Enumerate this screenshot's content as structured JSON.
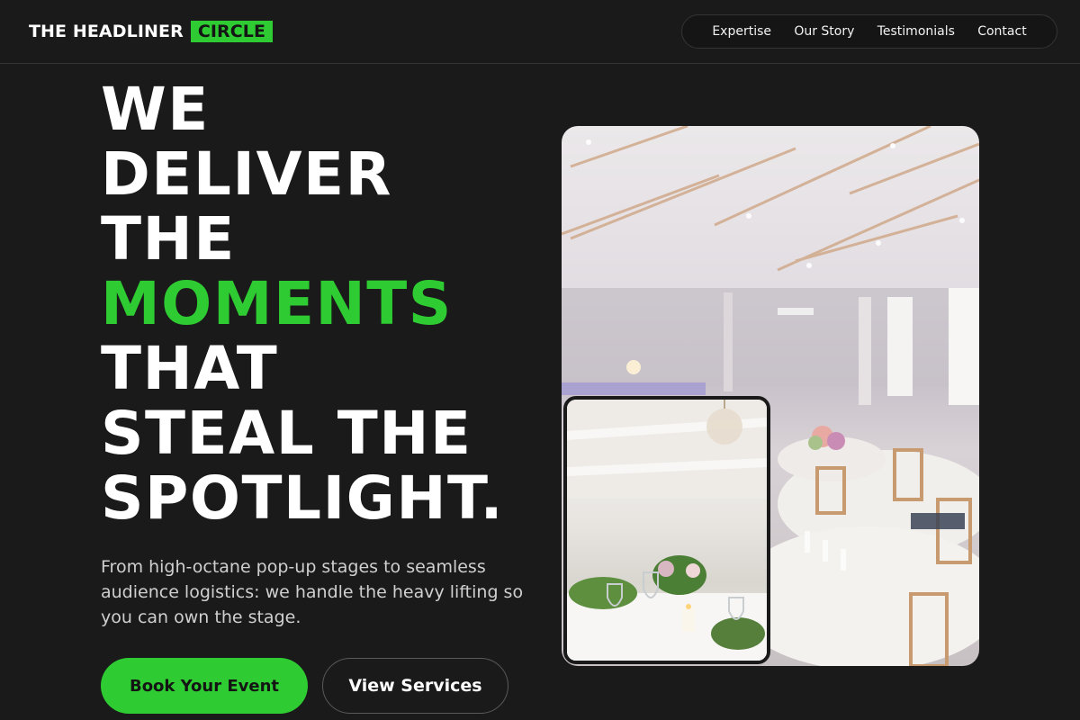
{
  "brand": {
    "name": "THE HEADLINER",
    "highlight": "CIRCLE",
    "accent_color": "#2ecc32"
  },
  "nav": {
    "items": [
      "Expertise",
      "Our Story",
      "Testimonials",
      "Contact"
    ]
  },
  "hero": {
    "headline_lines": [
      "WE",
      "DELIVER",
      "THE",
      "MOMENTS",
      "THAT",
      "STEAL THE",
      "SPOTLIGHT."
    ],
    "highlighted_line": "MOMENTS",
    "subtext": "From high-octane pop-up stages to seamless audience logistics: we handle the heavy lifting so you can own the stage.",
    "primary_cta": "Book Your Event",
    "secondary_cta": "View Services"
  },
  "images": {
    "main": "event-hall-photo",
    "inset": "table-setting-photo"
  }
}
